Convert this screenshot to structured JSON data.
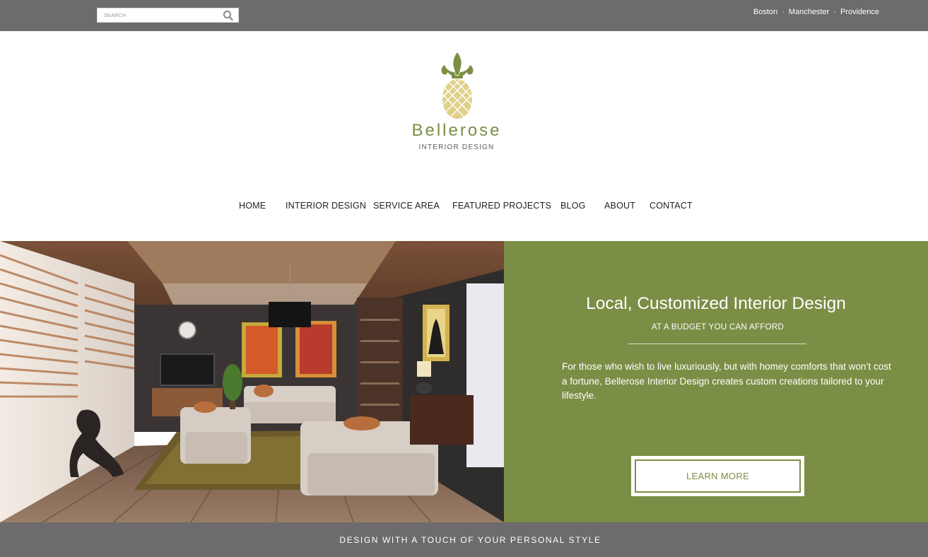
{
  "topbar": {
    "search_placeholder": "SEARCH",
    "search_icon": "search-icon",
    "cities": [
      "Boston",
      "Manchester",
      "Providence"
    ],
    "separator": "·"
  },
  "logo": {
    "icon": "fleur-de-lis-pineapple-icon",
    "brand": "Bellerose",
    "tagline": "INTERIOR DESIGN"
  },
  "nav": {
    "items": [
      "HOME",
      "INTERIOR DESIGN",
      "SERVICE AREA",
      "FEATURED PROJECTS",
      "BLOG",
      "ABOUT",
      "CONTACT"
    ]
  },
  "hero": {
    "title": "Local, Customized Interior Design",
    "subtitle": "AT A BUDGET YOU CAN AFFORD",
    "body": "For those who wish to live luxuriously, but with homey comforts that won’t cost a fortune, Bellerose Interior Design creates custom creations tailored to your lifestyle.",
    "button_label": "LEARN MORE",
    "image": "living-room-photo"
  },
  "strip": {
    "text": "DESIGN WITH A TOUCH OF YOUR PERSONAL STYLE"
  },
  "colors": {
    "accent_green": "#7b8e46",
    "bar_gray": "#6d6b6d",
    "logo_gold": "#e0d08a"
  }
}
